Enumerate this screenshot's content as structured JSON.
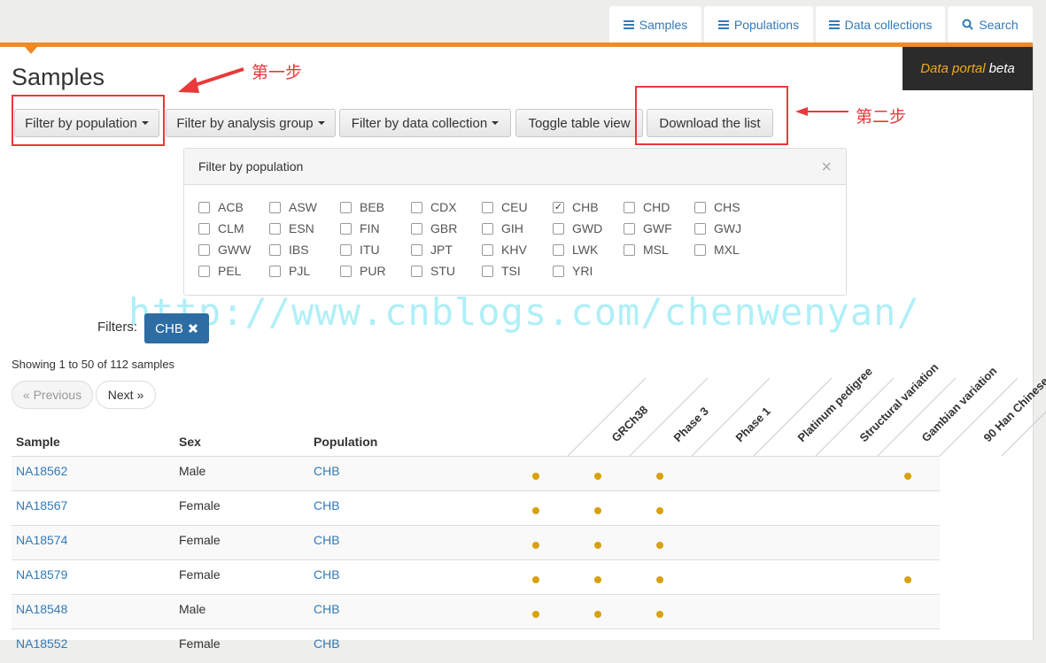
{
  "nav": {
    "tabs": [
      {
        "label": "Samples",
        "icon": "list-icon"
      },
      {
        "label": "Populations",
        "icon": "list-icon"
      },
      {
        "label": "Data collections",
        "icon": "list-icon"
      },
      {
        "label": "Search",
        "icon": "search-icon"
      }
    ]
  },
  "page_title": "Samples",
  "portal_badge": {
    "highlight": "Data portal",
    "rest": "beta"
  },
  "toolbar": {
    "filter_population": "Filter by population",
    "filter_analysis": "Filter by analysis group",
    "filter_collection": "Filter by data collection",
    "toggle_view": "Toggle table view",
    "download": "Download the list"
  },
  "annotations": {
    "step1": "第一步",
    "step2": "第二步"
  },
  "filter_panel": {
    "title": "Filter by population",
    "close": "×",
    "populations": [
      {
        "code": "ACB",
        "checked": false
      },
      {
        "code": "ASW",
        "checked": false
      },
      {
        "code": "BEB",
        "checked": false
      },
      {
        "code": "CDX",
        "checked": false
      },
      {
        "code": "CEU",
        "checked": false
      },
      {
        "code": "CHB",
        "checked": true
      },
      {
        "code": "CHD",
        "checked": false
      },
      {
        "code": "CHS",
        "checked": false
      },
      {
        "code": "CLM",
        "checked": false
      },
      {
        "code": "ESN",
        "checked": false
      },
      {
        "code": "FIN",
        "checked": false
      },
      {
        "code": "GBR",
        "checked": false
      },
      {
        "code": "GIH",
        "checked": false
      },
      {
        "code": "GWD",
        "checked": false
      },
      {
        "code": "GWF",
        "checked": false
      },
      {
        "code": "GWJ",
        "checked": false
      },
      {
        "code": "GWW",
        "checked": false
      },
      {
        "code": "IBS",
        "checked": false
      },
      {
        "code": "ITU",
        "checked": false
      },
      {
        "code": "JPT",
        "checked": false
      },
      {
        "code": "KHV",
        "checked": false
      },
      {
        "code": "LWK",
        "checked": false
      },
      {
        "code": "MSL",
        "checked": false
      },
      {
        "code": "MXL",
        "checked": false
      },
      {
        "code": "PEL",
        "checked": false
      },
      {
        "code": "PJL",
        "checked": false
      },
      {
        "code": "PUR",
        "checked": false
      },
      {
        "code": "STU",
        "checked": false
      },
      {
        "code": "TSI",
        "checked": false
      },
      {
        "code": "YRI",
        "checked": false
      }
    ]
  },
  "filters": {
    "label": "Filters:",
    "active": "CHB",
    "remove_icon": "close-icon"
  },
  "watermark": "http://www.cnblogs.com/chenwenyan/",
  "paging": {
    "showing": "Showing 1 to 50 of 112 samples",
    "previous": "« Previous",
    "next": "Next »"
  },
  "table": {
    "headers": {
      "sample": "Sample",
      "sex": "Sex",
      "population": "Population"
    },
    "data_columns": [
      "GRCh38",
      "Phase 3",
      "Phase 1",
      "Platinum pedigree",
      "Structural variation",
      "Gambian variation",
      "90 Han Chinese"
    ],
    "rows": [
      {
        "sample": "NA18562",
        "sex": "Male",
        "population": "CHB",
        "marks": [
          true,
          true,
          true,
          false,
          false,
          false,
          true
        ]
      },
      {
        "sample": "NA18567",
        "sex": "Female",
        "population": "CHB",
        "marks": [
          true,
          true,
          true,
          false,
          false,
          false,
          false
        ]
      },
      {
        "sample": "NA18574",
        "sex": "Female",
        "population": "CHB",
        "marks": [
          true,
          true,
          true,
          false,
          false,
          false,
          false
        ]
      },
      {
        "sample": "NA18579",
        "sex": "Female",
        "population": "CHB",
        "marks": [
          true,
          true,
          true,
          false,
          false,
          false,
          true
        ]
      },
      {
        "sample": "NA18548",
        "sex": "Male",
        "population": "CHB",
        "marks": [
          true,
          true,
          true,
          false,
          false,
          false,
          false
        ]
      },
      {
        "sample": "NA18552",
        "sex": "Female",
        "population": "CHB",
        "marks": [
          false,
          false,
          false,
          false,
          false,
          false,
          false
        ]
      }
    ]
  },
  "colors": {
    "accent": "#f08a24",
    "link": "#337ab7",
    "dot": "#d7a10f",
    "annotation": "#e8393b"
  }
}
